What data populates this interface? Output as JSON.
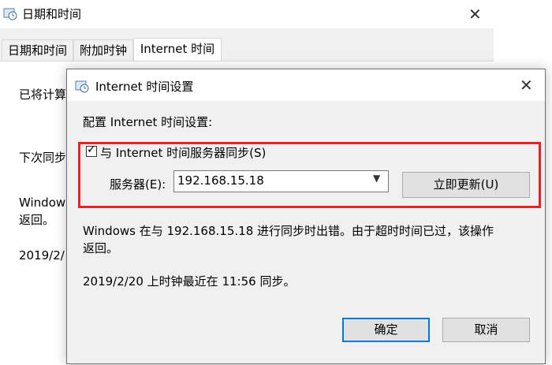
{
  "bg_window": {
    "title": "日期和时间",
    "tabs": [
      "日期和时间",
      "附加时钟",
      "Internet 时间"
    ],
    "line1": "已将计算",
    "line2": "下次同步",
    "line3a": "Window",
    "line3b": "返回。",
    "line4": "2019/2/"
  },
  "dialog": {
    "title": "Internet 时间设置",
    "heading": "配置 Internet 时间设置:",
    "sync_checkbox_label": "与 Internet 时间服务器同步(S)",
    "sync_checked": true,
    "server_label": "服务器(E):",
    "server_value": "192.168.15.18",
    "update_button": "立即更新(U)",
    "error_line1": "Windows 在与 192.168.15.18 进行同步时出错。由于超时时间已过，该操作",
    "error_line2": "返回。",
    "last_sync": "2019/2/20 上时钟最近在 11:56 同步。",
    "ok_button": "确定",
    "cancel_button": "取消"
  },
  "colors": {
    "highlight_border": "#e6212a",
    "default_button_border": "#0078d7"
  }
}
